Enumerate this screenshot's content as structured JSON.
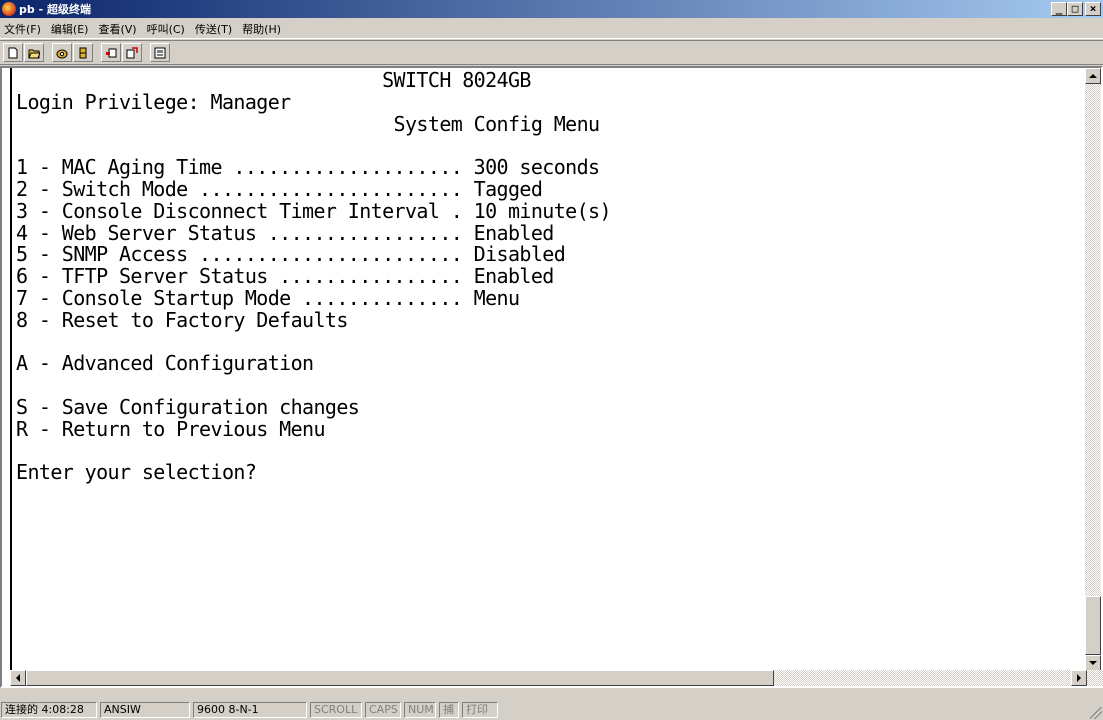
{
  "window": {
    "title": "pb - 超级终端",
    "minimize_label": "_",
    "maximize_label": "□",
    "close_label": "×"
  },
  "menu": {
    "items": [
      "文件(F)",
      "编辑(E)",
      "查看(V)",
      "呼叫(C)",
      "传送(T)",
      "帮助(H)"
    ]
  },
  "toolbar": {
    "icons": [
      "new-icon",
      "open-icon",
      "call-icon",
      "disconnect-icon",
      "send-icon",
      "receive-icon",
      "properties-icon"
    ]
  },
  "terminal": {
    "lines": [
      "                                SWITCH 8024GB",
      "Login Privilege: Manager",
      "                                 System Config Menu",
      "",
      "1 - MAC Aging Time .................... 300 seconds",
      "2 - Switch Mode ....................... Tagged",
      "3 - Console Disconnect Timer Interval . 10 minute(s)",
      "4 - Web Server Status ................. Enabled",
      "5 - SNMP Access ....................... Disabled",
      "6 - TFTP Server Status ................ Enabled",
      "7 - Console Startup Mode .............. Menu",
      "8 - Reset to Factory Defaults",
      "",
      "A - Advanced Configuration",
      "",
      "S - Save Configuration changes",
      "R - Return to Previous Menu",
      "",
      "Enter your selection?"
    ]
  },
  "statusbar": {
    "connection": "连接的 4:08:28",
    "emulation": "ANSIW",
    "port_settings": "9600 8-N-1",
    "scroll": "SCROLL",
    "caps": "CAPS",
    "num": "NUM",
    "capture": "捕",
    "print": "打印"
  },
  "colors": {
    "titlebar_start": "#0a246a",
    "titlebar_end": "#a6caf0",
    "chrome": "#d4d0c8",
    "terminal_bg": "#ffffff",
    "terminal_fg": "#000000"
  }
}
